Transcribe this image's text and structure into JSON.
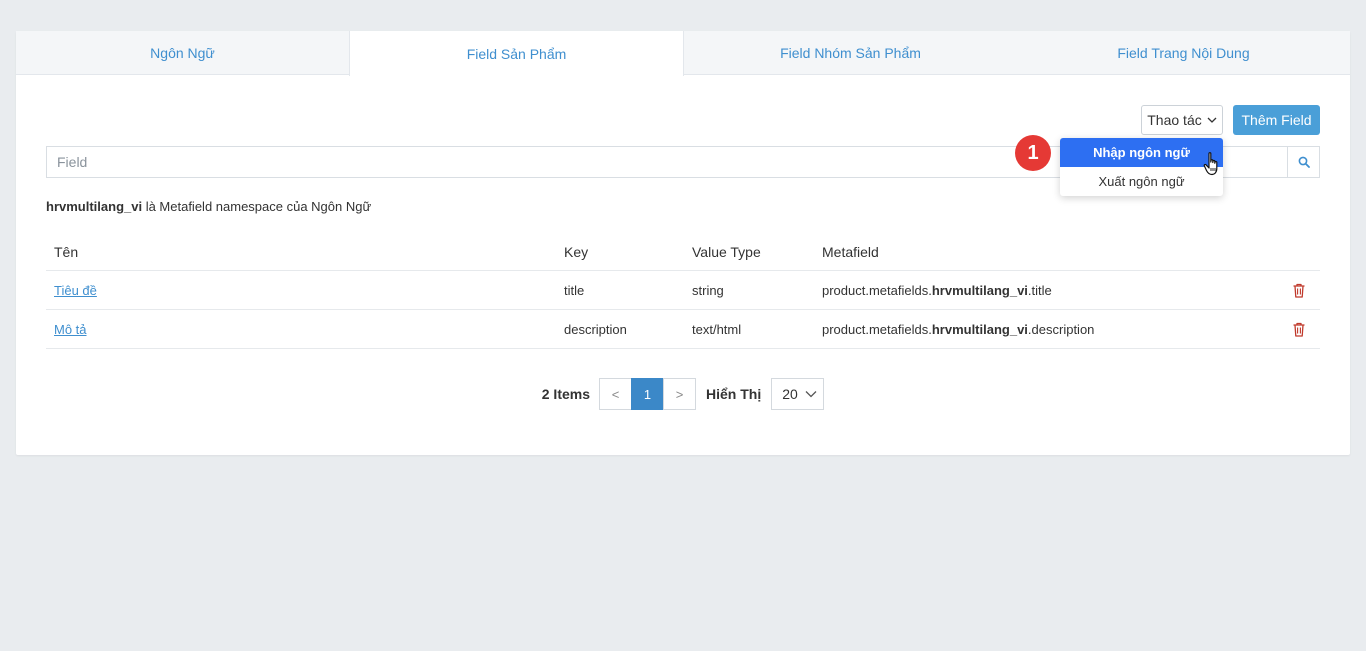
{
  "tabs": [
    {
      "label": "Ngôn Ngữ",
      "active": false
    },
    {
      "label": "Field Sản Phẩm",
      "active": true
    },
    {
      "label": "Field Nhóm Sản Phẩm",
      "active": false
    },
    {
      "label": "Field Trang Nội Dung",
      "active": false
    }
  ],
  "toolbar": {
    "actions_label": "Thao tác",
    "add_label": "Thêm Field"
  },
  "dropdown": {
    "items": [
      {
        "label": "Nhập ngôn ngữ",
        "highlighted": true
      },
      {
        "label": "Xuất ngôn ngữ",
        "highlighted": false
      }
    ]
  },
  "annotation": {
    "step": "1",
    "color": "#e53935"
  },
  "search": {
    "placeholder": "Field",
    "value": ""
  },
  "namespace_note": {
    "namespace": "hrvmultilang_vi",
    "text": " là Metafield namespace của Ngôn Ngữ"
  },
  "table": {
    "headers": {
      "name": "Tên",
      "key": "Key",
      "value_type": "Value Type",
      "metafield": "Metafield"
    },
    "rows": [
      {
        "name": "Tiêu đề",
        "key": "title",
        "value_type": "string",
        "metafield_prefix": "product.metafields.",
        "metafield_ns": "hrvmultilang_vi",
        "metafield_suffix": ".title"
      },
      {
        "name": "Mô tả",
        "key": "description",
        "value_type": "text/html",
        "metafield_prefix": "product.metafields.",
        "metafield_ns": "hrvmultilang_vi",
        "metafield_suffix": ".description"
      }
    ]
  },
  "pagination": {
    "count": "2 Items",
    "prev": "<",
    "current": "1",
    "next": ">",
    "show_label": "Hiển Thị",
    "page_size": "20"
  },
  "colors": {
    "accent": "#4a9fd8",
    "tab_text": "#3f8fcf",
    "dropdown_highlight": "#2d6ff2",
    "trash": "#c0392b"
  },
  "icons": {
    "search": "search-icon",
    "trash": "trash-icon",
    "chevron": "chevron-down-icon",
    "cursor": "hand-cursor-icon"
  }
}
